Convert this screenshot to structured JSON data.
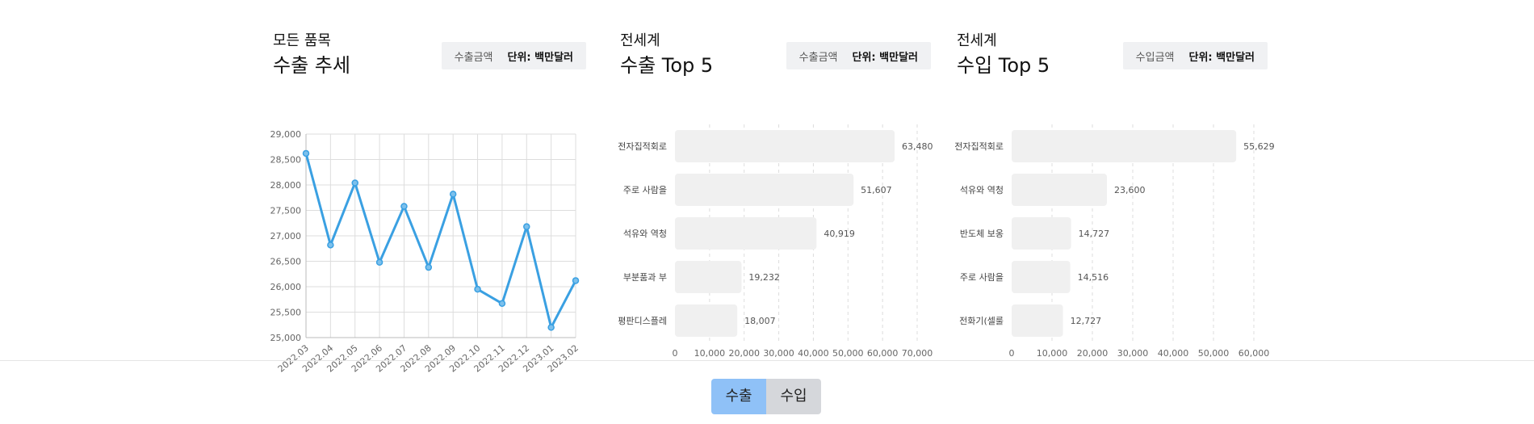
{
  "panels": {
    "trend": {
      "subtitle": "모든 품목",
      "title": "수출 추세",
      "unit_key": "수출금액",
      "unit_value": "단위: 백만달러"
    },
    "export_top": {
      "subtitle": "전세계",
      "title": "수출 Top 5",
      "unit_key": "수출금액",
      "unit_value": "단위: 백만달러"
    },
    "import_top": {
      "subtitle": "전세계",
      "title": "수입 Top 5",
      "unit_key": "수입금액",
      "unit_value": "단위: 백만달러"
    }
  },
  "toggle": {
    "export_label": "수출",
    "import_label": "수입",
    "selected": "수출"
  },
  "colors": {
    "line": "#3aa0e2",
    "bar": "#f0f0f0",
    "grid": "#dddddd",
    "toggle_on": "#8fc1f7",
    "toggle_off": "#d5d7db"
  },
  "chart_data": [
    {
      "type": "line",
      "x": [
        "2022.03",
        "2022.04",
        "2022.05",
        "2022.06",
        "2022.07",
        "2022.08",
        "2022.09",
        "2022.10",
        "2022.11",
        "2022.12",
        "2023.01",
        "2023.02"
      ],
      "values": [
        28620,
        26820,
        28040,
        26480,
        27580,
        26380,
        27820,
        25950,
        25670,
        27180,
        25200,
        26120
      ],
      "yticks": [
        "29,000",
        "28,500",
        "28,000",
        "27,500",
        "27,000",
        "26,500",
        "26,000",
        "25,500",
        "25,000"
      ],
      "ylim": [
        25000,
        29000
      ],
      "grid": true
    },
    {
      "type": "bar",
      "orientation": "horizontal",
      "categories": [
        "전자집적회로",
        "주로 사람을",
        "석유와 역청",
        "부분품과 부",
        "평판디스플레"
      ],
      "values": [
        63480,
        51607,
        40919,
        19232,
        18007
      ],
      "value_labels": [
        "63,480",
        "51,607",
        "40,919",
        "19,232",
        "18,007"
      ],
      "xticks": [
        "0",
        "10,000",
        "20,000",
        "30,000",
        "40,000",
        "50,000",
        "60,000",
        "70,000"
      ],
      "xlim": [
        0,
        70000
      ]
    },
    {
      "type": "bar",
      "orientation": "horizontal",
      "categories": [
        "전자집적회로",
        "석유와 역청",
        "반도체 보옹",
        "주로 사람을",
        "전화기(셀룰"
      ],
      "values": [
        55629,
        23600,
        14727,
        14516,
        12727
      ],
      "value_labels": [
        "55,629",
        "23,600",
        "14,727",
        "14,516",
        "12,727"
      ],
      "xticks": [
        "0",
        "10,000",
        "20,000",
        "30,000",
        "40,000",
        "50,000",
        "60,000"
      ],
      "xlim": [
        0,
        60000
      ]
    }
  ]
}
